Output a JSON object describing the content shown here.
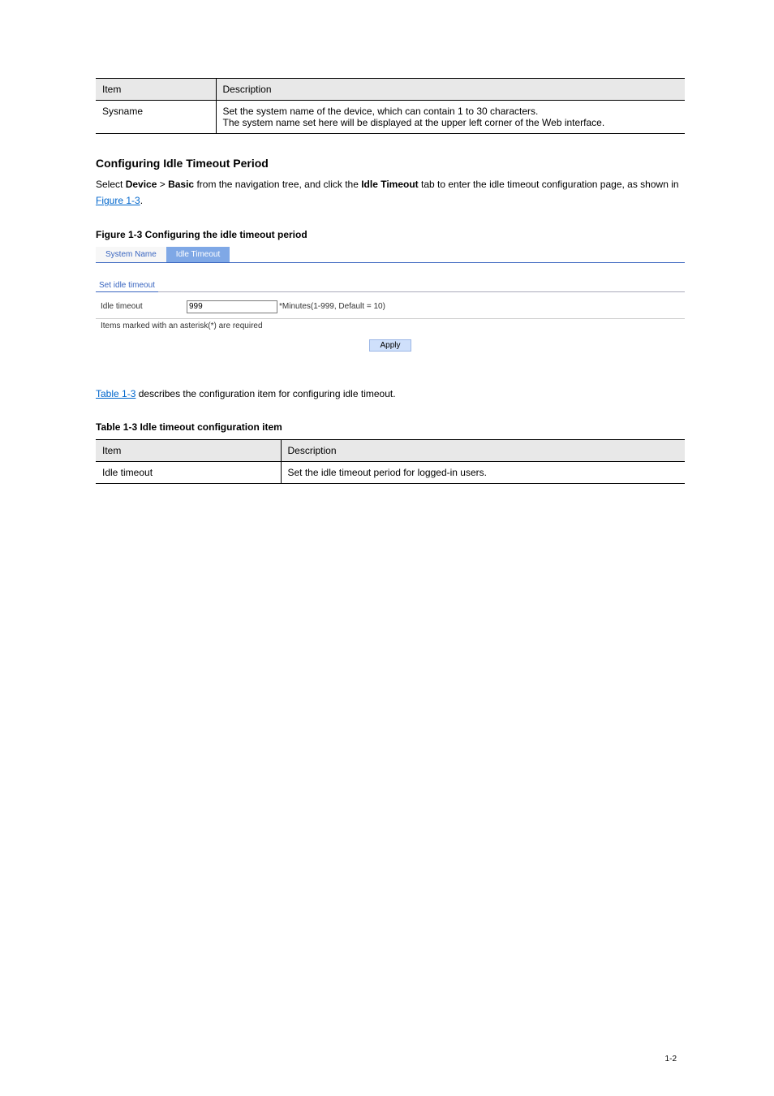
{
  "table1": {
    "h1": "Item",
    "h2": "Description",
    "row1_c1": "Sysname",
    "row1_c2": "Set the system name of the device, which can contain 1 to 30 characters.\nThe system name set here will be displayed at the upper left corner of the Web interface."
  },
  "section_heading": "Configuring Idle Timeout Period",
  "nav_text_1": "Select ",
  "nav_device": "Device",
  "nav_sep": " > ",
  "nav_basic": "Basic",
  "nav_text_2": " from the navigation tree, and click the ",
  "nav_tab": "Idle Timeout",
  "nav_text_3": " tab to enter the idle timeout configuration page, as shown in ",
  "fig_link": "Figure 1-3",
  "period": ".",
  "figure_caption": "Figure 1-3 Configuring the idle timeout period",
  "fig": {
    "tab1": "System Name",
    "tab2": "Idle Timeout",
    "sub": "Set idle timeout",
    "label": "Idle timeout",
    "value": "999",
    "hint": "*Minutes(1-999, Default = 10)",
    "note": "Items marked with an asterisk(*) are required",
    "apply": "Apply"
  },
  "table_ref": "Table 1-3",
  "body_text2": " describes the configuration item for configuring idle timeout.",
  "table2_caption": "Table 1-3 Idle timeout configuration item",
  "table2": {
    "h1": "Item",
    "h2": "Description",
    "row1_c1": "Idle timeout",
    "row1_c2": "Set the idle timeout period for logged-in users."
  },
  "pagenum": "1-2"
}
